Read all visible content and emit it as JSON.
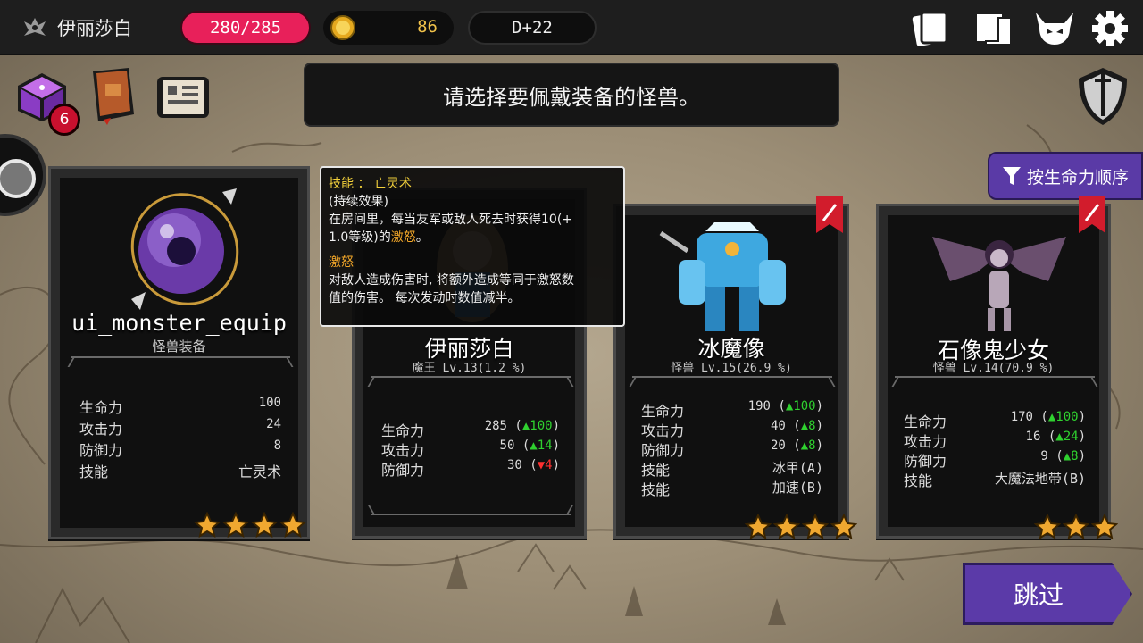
{
  "topbar": {
    "player_name": "伊丽莎白",
    "hp": "280/285",
    "gold": "86",
    "day": "D+22"
  },
  "badge_count": "6",
  "banner_text": "请选择要佩戴装备的怪兽。",
  "sort_label": "按生命力顺序",
  "skip_label": "跳过",
  "colors": {
    "hp_pill": "#e8205a",
    "gold_text": "#f1c24a",
    "accent_purple": "#5b3aa8",
    "stat_up": "#2fd12f",
    "stat_down": "#ff3030",
    "tooltip_title": "#f4d23c",
    "tooltip_keyword": "#f0a528"
  },
  "equip_card": {
    "name": "ui_monster_equip",
    "subtitle": "怪兽装备",
    "stats": [
      {
        "label": "生命力",
        "value": "100"
      },
      {
        "label": "攻击力",
        "value": "24"
      },
      {
        "label": "防御力",
        "value": "8"
      },
      {
        "label": "技能",
        "value": "亡灵术"
      }
    ],
    "stars": 4
  },
  "cards": [
    {
      "name": "伊丽莎白",
      "subtitle": "魔王 Lv.13(1.2 %)",
      "stats": [
        {
          "label": "生命力",
          "value": "285",
          "delta": "▲100",
          "dir": "up"
        },
        {
          "label": "攻击力",
          "value": "50",
          "delta": "▲14",
          "dir": "up"
        },
        {
          "label": "防御力",
          "value": "30",
          "delta": "▼4",
          "dir": "down"
        }
      ]
    },
    {
      "name": "冰魔像",
      "subtitle": "怪兽 Lv.15(26.9 %)",
      "stats": [
        {
          "label": "生命力",
          "value": "190",
          "delta": "▲100",
          "dir": "up"
        },
        {
          "label": "攻击力",
          "value": "40",
          "delta": "▲8",
          "dir": "up"
        },
        {
          "label": "防御力",
          "value": "20",
          "delta": "▲8",
          "dir": "up"
        },
        {
          "label": "技能",
          "value": "冰甲(A)"
        },
        {
          "label": "技能",
          "value": "加速(B)"
        }
      ],
      "stars": 4
    },
    {
      "name": "石像鬼少女",
      "subtitle": "怪兽 Lv.14(70.9 %)",
      "stats": [
        {
          "label": "生命力",
          "value": "170",
          "delta": "▲100",
          "dir": "up"
        },
        {
          "label": "攻击力",
          "value": "16",
          "delta": "▲24",
          "dir": "up"
        },
        {
          "label": "防御力",
          "value": "9",
          "delta": "▲8",
          "dir": "up"
        },
        {
          "label": "技能",
          "value": "大魔法地带(B)"
        }
      ],
      "stars": 3
    }
  ],
  "tooltip": {
    "title": "技能 ： 亡灵术",
    "line1": "(持续效果)",
    "line2a": "在房间里，每当友军或敌人死去时获得10(+",
    "line2b": "1.0等级)的",
    "keyword": "激怒",
    "line2c": "。",
    "term": "激怒",
    "desc1": "对敌人造成伤害时, 将额外造成等同于激怒数",
    "desc2": "值的伤害。  每次发动时数值减半。"
  },
  "icons": [
    "demon-crest-icon",
    "gold-coin-icon",
    "cards-icon",
    "map-scroll-icon",
    "demon-skull-icon",
    "gear-icon",
    "dice-icon",
    "spellbook-icon",
    "recipe-scroll-icon",
    "shield-sword-icon",
    "funnel-icon",
    "star-icon",
    "bookmark-ribbon-icon"
  ]
}
